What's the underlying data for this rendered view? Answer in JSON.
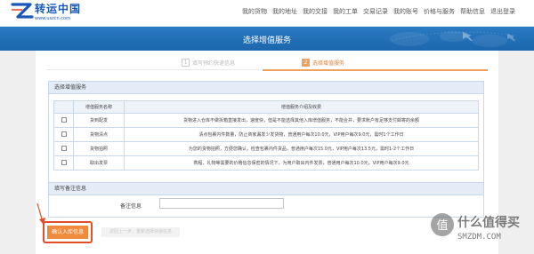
{
  "header": {
    "logo_cn": "转运中国",
    "logo_url": "www.uszcn.com",
    "nav": [
      "我的货物",
      "我的地址",
      "我的交接",
      "我的工单",
      "交易记录",
      "我的账号",
      "价格与服务",
      "帮助信息",
      "退出登录"
    ]
  },
  "banner": {
    "title": "选择增值服务"
  },
  "steps": [
    {
      "num": "1",
      "label": "填写预约快递信息",
      "state": "done"
    },
    {
      "num": "2",
      "label": "选择增值服务",
      "state": "active"
    }
  ],
  "services_panel": {
    "title": "选择增值服务",
    "headers": [
      "增值服务名称",
      "增值服务介绍及收费"
    ],
    "rows": [
      {
        "name": "货到配发",
        "desc": "货物进入仓库不做拆箱直接发出，速度快，但是不能选择其他入库增值服务，不能合并，要求账户有足够支付邮寄的余额"
      },
      {
        "name": "货物清点",
        "desc": "清点包裹内件数量，防止商家漏发少发货物，普通用户每次10.0元，VIP用户每次9.0元，需时1个工作日"
      },
      {
        "name": "货物拍照",
        "desc": "为您的货物拍照，方便您确认，检查包裹内件货品，普通用户每次15.0元，VIP用户每次13.5元，需时1-2个工作日"
      },
      {
        "name": "取出发票",
        "desc": "携程、礼物等需要的价格信息保密的情况下，为用户取出内件发票，普通用户每次10.0元，VIP用户每次9.0元"
      }
    ]
  },
  "remark_panel": {
    "title": "填写备注信息",
    "label": "备注信息",
    "value": ""
  },
  "buttons": {
    "confirm": "确认入库信息",
    "prev": "返回上一步，重新选择快递信息"
  },
  "watermark": {
    "cn": "什么值得买",
    "en": "SMZDM.COM"
  },
  "colors": {
    "brand_blue": "#1a57b8",
    "banner_blue": "#1f6fb6",
    "accent_orange": "#f08a3c",
    "highlight_red": "#e44d2a"
  }
}
